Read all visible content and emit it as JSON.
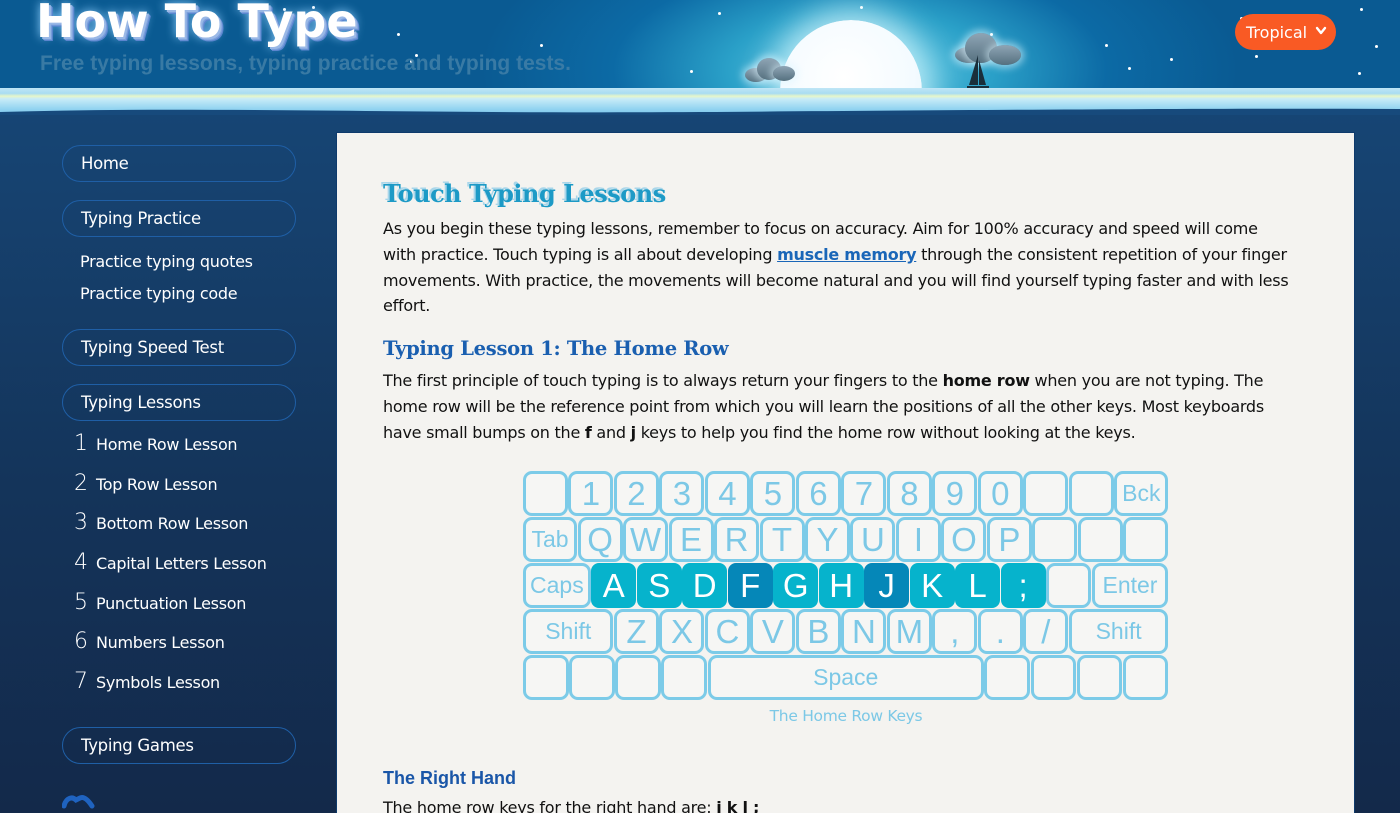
{
  "header": {
    "site_title": "How To Type",
    "tagline": "Free typing lessons, typing practice and typing tests.",
    "theme_select": {
      "selected": "Tropical",
      "color": "#f95a24"
    }
  },
  "sidebar": {
    "home": "Home",
    "typing_practice": "Typing Practice",
    "practice_subitems": [
      "Practice typing quotes",
      "Practice typing code"
    ],
    "typing_speed_test": "Typing Speed Test",
    "typing_lessons": "Typing Lessons",
    "lessons": [
      {
        "num": "1",
        "label": "Home Row Lesson"
      },
      {
        "num": "2",
        "label": "Top Row Lesson"
      },
      {
        "num": "3",
        "label": "Bottom Row Lesson"
      },
      {
        "num": "4",
        "label": "Capital Letters Lesson"
      },
      {
        "num": "5",
        "label": "Punctuation Lesson"
      },
      {
        "num": "6",
        "label": "Numbers Lesson"
      },
      {
        "num": "7",
        "label": "Symbols Lesson"
      }
    ],
    "typing_games": "Typing Games"
  },
  "content": {
    "title": "Touch Typing Lessons",
    "intro_before_link": "As you begin these typing lessons, remember to focus on accuracy. Aim for 100% accuracy and speed will come with practice. Touch typing is all about developing ",
    "intro_link": "muscle memory",
    "intro_after_link": " through the consistent repetition of your finger movements. With practice, the movements will become natural and you will find yourself typing faster and with less effort.",
    "lesson_title": "Typing Lesson 1: The Home Row",
    "lesson_p1": "The first principle of touch typing is to always return your fingers to the ",
    "lesson_bold1": "home row",
    "lesson_p2": " when you are not typing. The home row will be the reference point from which you will learn the positions of all the other keys. Most keyboards have small bumps on the ",
    "lesson_bold_f": "f",
    "lesson_and": " and ",
    "lesson_bold_j": "j",
    "lesson_p3": " keys to help you find the home row without looking at the keys.",
    "keyboard_caption": "The Home Row Keys",
    "right_hand_heading": "The Right Hand",
    "right_hand_text": "The home row keys for the right hand are: ",
    "right_hand_keys": "j k l ;"
  },
  "keyboard": {
    "colors": {
      "outline": "#7ccbe8",
      "home": "#06b3cc",
      "bump": "#0587b8"
    },
    "rows": [
      [
        {
          "l": "",
          "w": 1
        },
        {
          "l": "1",
          "w": 1
        },
        {
          "l": "2",
          "w": 1
        },
        {
          "l": "3",
          "w": 1
        },
        {
          "l": "4",
          "w": 1
        },
        {
          "l": "5",
          "w": 1
        },
        {
          "l": "6",
          "w": 1
        },
        {
          "l": "7",
          "w": 1
        },
        {
          "l": "8",
          "w": 1
        },
        {
          "l": "9",
          "w": 1
        },
        {
          "l": "0",
          "w": 1
        },
        {
          "l": "",
          "w": 1
        },
        {
          "l": "",
          "w": 1
        },
        {
          "l": "Bck",
          "w": 1.2,
          "s": 1
        }
      ],
      [
        {
          "l": "Tab",
          "w": 1.2,
          "s": 1
        },
        {
          "l": "Q",
          "w": 1
        },
        {
          "l": "W",
          "w": 1
        },
        {
          "l": "E",
          "w": 1
        },
        {
          "l": "R",
          "w": 1
        },
        {
          "l": "T",
          "w": 1
        },
        {
          "l": "Y",
          "w": 1
        },
        {
          "l": "U",
          "w": 1
        },
        {
          "l": "I",
          "w": 1
        },
        {
          "l": "O",
          "w": 1
        },
        {
          "l": "P",
          "w": 1
        },
        {
          "l": "",
          "w": 1
        },
        {
          "l": "",
          "w": 1
        },
        {
          "l": "",
          "w": 1
        }
      ],
      [
        {
          "l": "Caps",
          "w": 1.5,
          "s": 1
        },
        {
          "l": "A",
          "w": 1,
          "h": 1
        },
        {
          "l": "S",
          "w": 1,
          "h": 1
        },
        {
          "l": "D",
          "w": 1,
          "h": 1
        },
        {
          "l": "F",
          "w": 1,
          "h": 1,
          "b": 1
        },
        {
          "l": "G",
          "w": 1,
          "h": 1
        },
        {
          "l": "H",
          "w": 1,
          "h": 1
        },
        {
          "l": "J",
          "w": 1,
          "h": 1,
          "b": 1
        },
        {
          "l": "K",
          "w": 1,
          "h": 1
        },
        {
          "l": "L",
          "w": 1,
          "h": 1
        },
        {
          "l": ";",
          "w": 1,
          "h": 1
        },
        {
          "l": "",
          "w": 1
        },
        {
          "l": "Enter",
          "w": 1.7,
          "s": 1
        }
      ],
      [
        {
          "l": "Shift",
          "w": 2,
          "s": 1
        },
        {
          "l": "Z",
          "w": 1
        },
        {
          "l": "X",
          "w": 1
        },
        {
          "l": "C",
          "w": 1
        },
        {
          "l": "V",
          "w": 1
        },
        {
          "l": "B",
          "w": 1
        },
        {
          "l": "N",
          "w": 1
        },
        {
          "l": "M",
          "w": 1
        },
        {
          "l": ",",
          "w": 1
        },
        {
          "l": ".",
          "w": 1
        },
        {
          "l": "/",
          "w": 1
        },
        {
          "l": "Shift",
          "w": 2.2,
          "s": 1
        }
      ],
      [
        {
          "l": "",
          "w": 1
        },
        {
          "l": "",
          "w": 1
        },
        {
          "l": "",
          "w": 1
        },
        {
          "l": "",
          "w": 1
        },
        {
          "l": "Space",
          "w": 6,
          "s": 1
        },
        {
          "l": "",
          "w": 1
        },
        {
          "l": "",
          "w": 1
        },
        {
          "l": "",
          "w": 1
        },
        {
          "l": "",
          "w": 1
        }
      ]
    ]
  }
}
